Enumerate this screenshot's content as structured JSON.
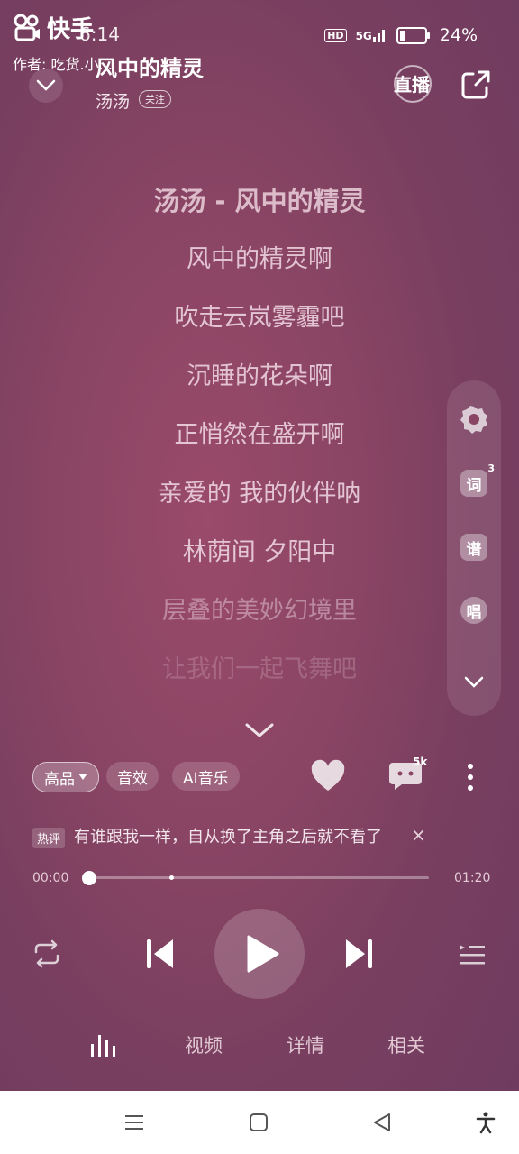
{
  "watermark": {
    "app_name": "快手",
    "author": "作者: 吃货.小..."
  },
  "status_bar": {
    "time": "6:14",
    "hd": "HD",
    "network": "5G",
    "battery": "24%"
  },
  "header": {
    "song_title": "风中的精灵",
    "artist": "汤汤",
    "follow": "关注",
    "live": "直播"
  },
  "lyrics": [
    "汤汤 - 风中的精灵",
    "风中的精灵啊",
    "吹走云岚雾霾吧",
    "沉睡的花朵啊",
    "正悄然在盛开啊",
    "亲爱的 我的伙伴呐",
    "林荫间 夕阳中",
    "层叠的美妙幻境里",
    "让我们一起飞舞吧"
  ],
  "side_panel": {
    "lyrics_btn": "词",
    "lyrics_count": "3",
    "score_btn": "谱",
    "sing_btn": "唱"
  },
  "chips": {
    "quality": "高品",
    "effect": "音效",
    "ai": "AI音乐"
  },
  "comment_count": "5k",
  "hot_comment": {
    "tag": "热评",
    "text": "有谁跟我一样，自从换了主角之后就不看了",
    "close": "×"
  },
  "progress": {
    "current": "00:00",
    "total": "01:20",
    "fraction": 0.0
  },
  "tabs": [
    "视频",
    "详情",
    "相关"
  ],
  "colors": {
    "background": "#7f4262",
    "accent": "#ffffff"
  }
}
